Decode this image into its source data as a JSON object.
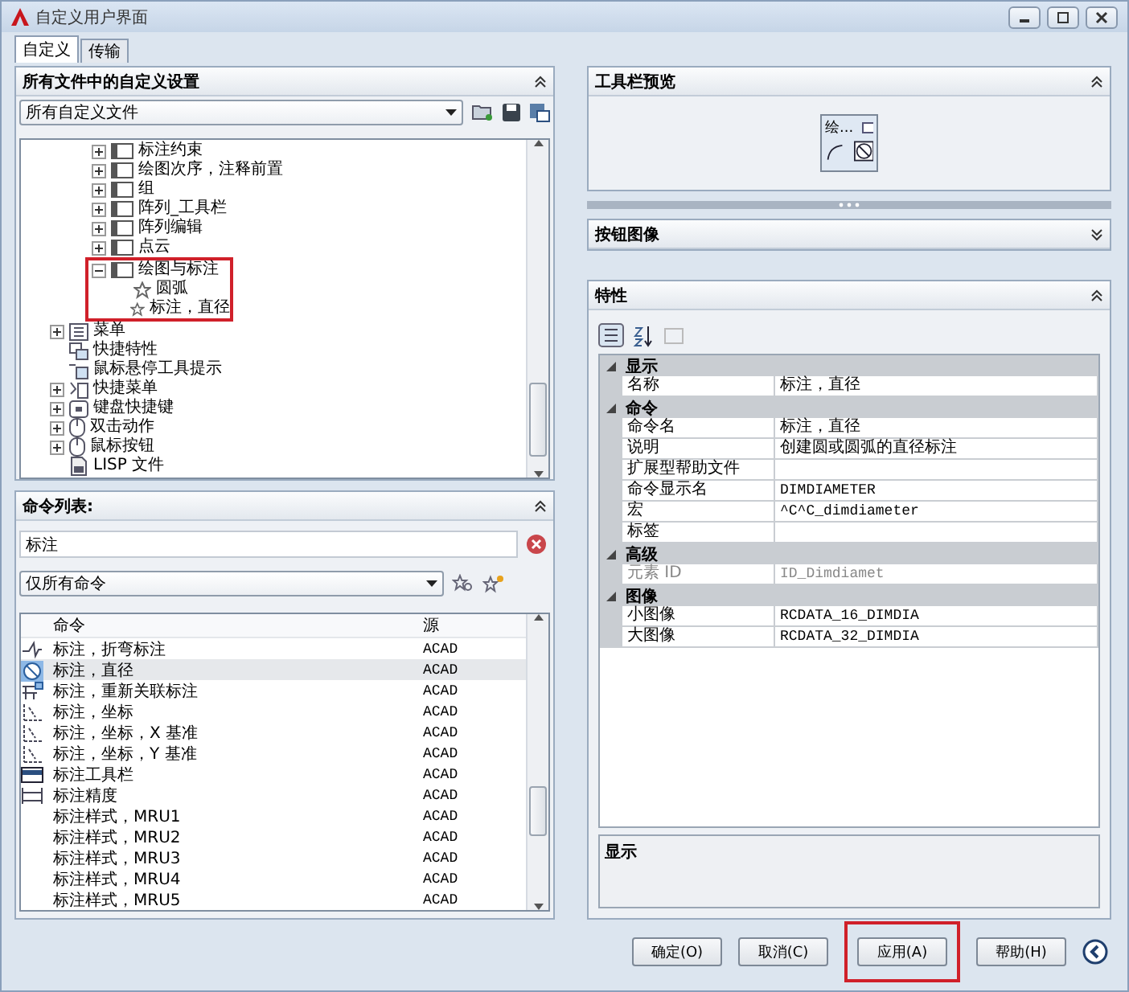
{
  "window": {
    "title": "自定义用户界面"
  },
  "tabs": [
    {
      "label": "自定义",
      "selected": true
    },
    {
      "label": "传输",
      "selected": false
    }
  ],
  "customizations_panel": {
    "title": "所有文件中的自定义设置",
    "expanded": true,
    "file_select": "所有自定义文件",
    "tree": [
      {
        "children": [
          {
            "label": "标注约束",
            "kind": "toolbar",
            "expanded": false,
            "annotated": false
          },
          {
            "label": "绘图次序，注释前置",
            "kind": "toolbar",
            "expanded": false,
            "annotated": false
          },
          {
            "label": "组",
            "kind": "toolbar",
            "expanded": false,
            "annotated": false
          },
          {
            "label": "阵列_工具栏",
            "kind": "toolbar",
            "expanded": false,
            "annotated": false
          },
          {
            "label": "阵列编辑",
            "kind": "toolbar",
            "expanded": false,
            "annotated": false
          },
          {
            "label": "点云",
            "kind": "toolbar",
            "expanded": false,
            "annotated": false
          },
          {
            "label": "绘图与标注",
            "kind": "toolbar",
            "expanded": true,
            "annotated": true,
            "children": [
              {
                "label": "圆弧",
                "kind": "command"
              },
              {
                "label": "标注，直径",
                "kind": "command"
              }
            ]
          }
        ]
      },
      {
        "label": "菜单",
        "kind": "menu",
        "expanded": false
      },
      {
        "label": "快捷特性",
        "kind": "quick-properties"
      },
      {
        "label": "鼠标悬停工具提示",
        "kind": "rollover"
      },
      {
        "label": "快捷菜单",
        "kind": "shortcut-menu",
        "expanded": false
      },
      {
        "label": "键盘快捷键",
        "kind": "keyboard",
        "expanded": false
      },
      {
        "label": "双击动作",
        "kind": "mouse",
        "expanded": false
      },
      {
        "label": "鼠标按钮",
        "kind": "mouse",
        "expanded": false
      },
      {
        "label": "LISP 文件",
        "kind": "lisp"
      }
    ]
  },
  "command_panel": {
    "title": "命令列表:",
    "expanded": true,
    "search": "标注",
    "filter": "仅所有命令",
    "columns": [
      "命令",
      "源"
    ],
    "rows": [
      {
        "kind": "jog",
        "command": "标注，折弯标注",
        "source": "ACAD",
        "selected": false
      },
      {
        "kind": "diameter",
        "command": "标注，直径",
        "source": "ACAD",
        "selected": true
      },
      {
        "kind": "reassociate",
        "command": "标注，重新关联标注",
        "source": "ACAD",
        "selected": false
      },
      {
        "kind": "ordinate",
        "command": "标注，坐标",
        "source": "ACAD",
        "selected": false
      },
      {
        "kind": "ordinate",
        "command": "标注，坐标，X 基准",
        "source": "ACAD",
        "selected": false
      },
      {
        "kind": "ordinate",
        "command": "标注，坐标，Y 基准",
        "source": "ACAD",
        "selected": false
      },
      {
        "kind": "toolbar",
        "command": "标注工具栏",
        "source": "ACAD",
        "selected": false
      },
      {
        "kind": "precision",
        "command": "标注精度",
        "source": "ACAD",
        "selected": false
      },
      {
        "kind": "plain",
        "command": "标注样式，MRU1",
        "source": "ACAD",
        "selected": false
      },
      {
        "kind": "plain",
        "command": "标注样式，MRU2",
        "source": "ACAD",
        "selected": false
      },
      {
        "kind": "plain",
        "command": "标注样式，MRU3",
        "source": "ACAD",
        "selected": false
      },
      {
        "kind": "plain",
        "command": "标注样式，MRU4",
        "source": "ACAD",
        "selected": false
      },
      {
        "kind": "plain",
        "command": "标注样式，MRU5",
        "source": "ACAD",
        "selected": false
      }
    ]
  },
  "toolbar_preview": {
    "title": "工具栏预览",
    "expanded": true,
    "toolbar_caption": "绘..."
  },
  "button_image": {
    "title": "按钮图像",
    "expanded": false
  },
  "properties": {
    "title": "特性",
    "expanded": true,
    "categories": [
      {
        "label": "显示",
        "expanded": true,
        "rows": [
          {
            "name": "名称",
            "value": "标注，直径",
            "disabled": false
          }
        ]
      },
      {
        "label": "命令",
        "expanded": true,
        "rows": [
          {
            "name": "命令名",
            "value": "标注，直径",
            "disabled": false
          },
          {
            "name": "说明",
            "value": "创建圆或圆弧的直径标注",
            "disabled": false
          },
          {
            "name": "扩展型帮助文件",
            "value": "",
            "disabled": false
          },
          {
            "name": "命令显示名",
            "value": "DIMDIAMETER",
            "disabled": false
          },
          {
            "name": "宏",
            "value": "^C^C_dimdiameter",
            "disabled": false
          },
          {
            "name": "标签",
            "value": "",
            "disabled": false
          }
        ]
      },
      {
        "label": "高级",
        "expanded": true,
        "rows": [
          {
            "name": "元素 ID",
            "value": "ID_Dimdiamet",
            "disabled": true
          }
        ]
      },
      {
        "label": "图像",
        "expanded": true,
        "rows": [
          {
            "name": "小图像",
            "value": "RCDATA_16_DIMDIA",
            "disabled": false
          },
          {
            "name": "大图像",
            "value": "RCDATA_32_DIMDIA",
            "disabled": false
          }
        ]
      }
    ],
    "description_title": "显示"
  },
  "buttons": [
    {
      "label": "确定(O)",
      "annotated": false
    },
    {
      "label": "取消(C)",
      "annotated": false
    },
    {
      "label": "应用(A)",
      "annotated": true
    },
    {
      "label": "帮助(H)",
      "annotated": false
    }
  ]
}
